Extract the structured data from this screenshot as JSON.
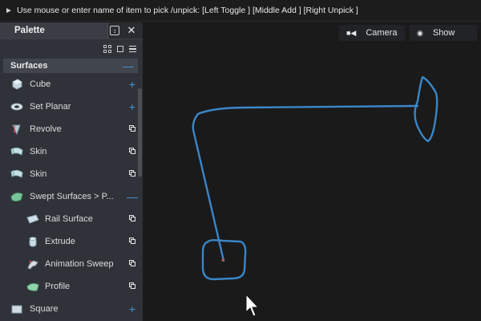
{
  "prompt": {
    "text": "Use mouse or enter name of item to pick /unpick: [Left Toggle ] [Middle Add ] [Right Unpick ]"
  },
  "palette": {
    "title": "Palette",
    "section": "Surfaces",
    "items": [
      {
        "label": "Cube",
        "action": "plus",
        "icon": "cube-icon"
      },
      {
        "label": "Set Planar",
        "action": "plus",
        "icon": "set-planar-icon"
      },
      {
        "label": "Revolve",
        "action": "copy",
        "icon": "revolve-icon"
      },
      {
        "label": "Skin",
        "action": "copy",
        "icon": "skin-icon"
      },
      {
        "label": "Skin",
        "action": "copy",
        "icon": "skin-icon"
      },
      {
        "label": "Swept Surfaces > P...",
        "action": "minus",
        "icon": "swept-surfaces-icon"
      },
      {
        "label": "Rail Surface",
        "action": "copy",
        "icon": "rail-surface-icon",
        "sub": true
      },
      {
        "label": "Extrude",
        "action": "copy",
        "icon": "extrude-icon",
        "sub": true
      },
      {
        "label": "Animation Sweep",
        "action": "copy",
        "icon": "animation-sweep-icon",
        "sub": true
      },
      {
        "label": "Profile",
        "action": "copy",
        "icon": "profile-icon",
        "sub": true
      },
      {
        "label": "Square",
        "action": "plus",
        "icon": "square-icon"
      }
    ]
  },
  "viewport": {
    "camera_label": "Camera",
    "show_label": "Show"
  },
  "colors": {
    "curve": "#3a86c8",
    "accent": "#4a90d9",
    "background": "#1a1a1a",
    "panel": "#2f3238"
  }
}
